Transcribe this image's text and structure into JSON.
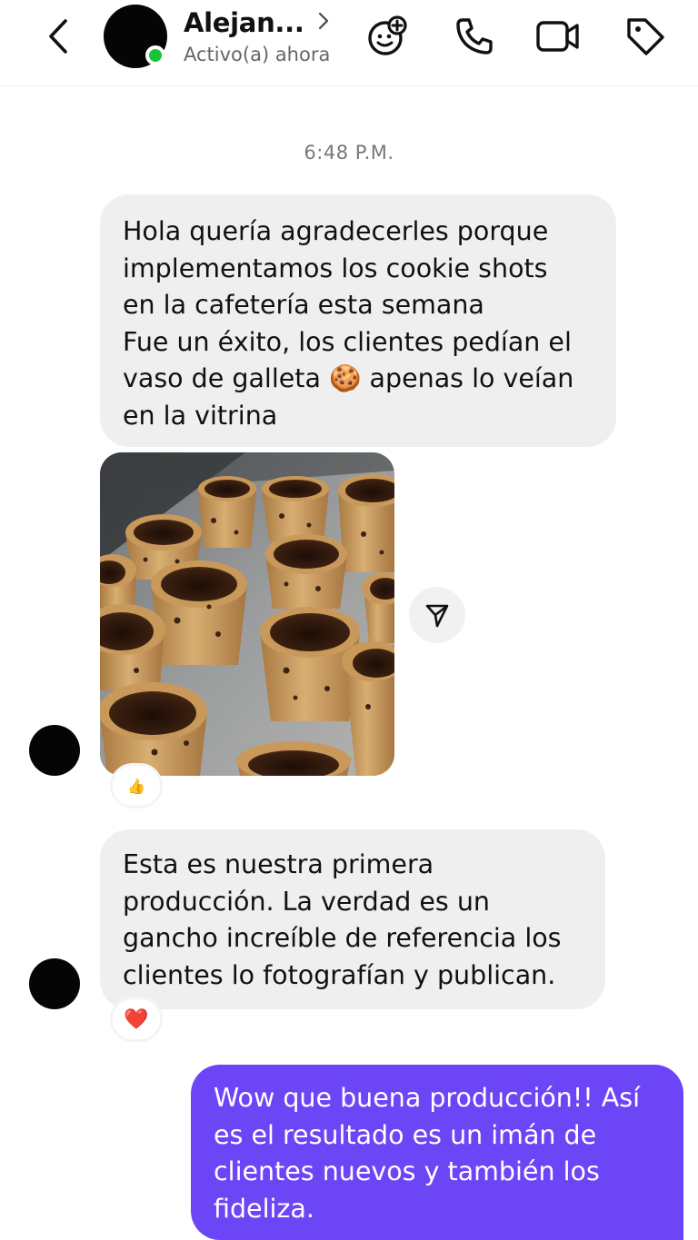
{
  "header": {
    "contact_name": "Alejan...",
    "status": "Activo(a) ahora",
    "icons": [
      "back-icon",
      "avatar",
      "chevron-right-icon",
      "add-effects-icon",
      "phone-icon",
      "video-icon",
      "tag-icon"
    ]
  },
  "thread": {
    "timestamp": "6:48 P.M.",
    "messages": [
      {
        "sender": "contact",
        "text_before_emoji": "Hola quería agradecerles porque\nimplementamos los cookie shots\nen la cafetería esta semana\nFue un éxito, los clientes pedían el\nvaso de galleta ",
        "emoji": "🍪",
        "text_after_emoji": " apenas lo veían\nen la vitrina"
      },
      {
        "sender": "contact",
        "type": "photo",
        "reaction": "👍"
      },
      {
        "sender": "contact",
        "text": "Esta es nuestra primera\nproducción. La verdad es un\ngancho increíble de referencia los\nclientes lo fotografían y publican.",
        "reaction": "❤️"
      },
      {
        "sender": "me",
        "text": "Wow que buena producción!! Así\nes el resultado es un imán de\nclientes nuevos y también los\nfideliza."
      }
    ]
  },
  "colors": {
    "outgoing_bubble": "#6c45f6",
    "incoming_bubble": "#efefef",
    "online": "#19c43a"
  }
}
